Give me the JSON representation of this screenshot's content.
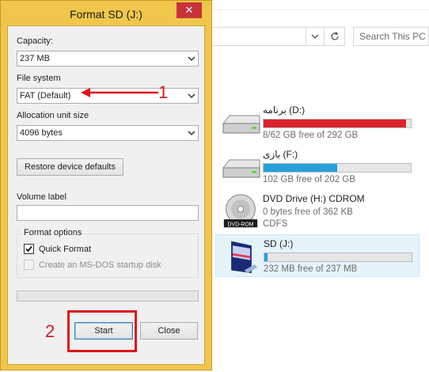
{
  "explorer": {
    "search_placeholder": "Search This PC",
    "drives": [
      {
        "name": "برنامه (D:)",
        "free_text": "8/62 GB free of 292 GB",
        "used_fraction": 0.97,
        "bar_color": "#d9252c"
      },
      {
        "name": "بازی (F:)",
        "free_text": "102 GB free of 202 GB",
        "used_fraction": 0.5,
        "bar_color": "#26a0da"
      },
      {
        "name": "DVD Drive (H:) CDROM",
        "free_text": "0 bytes free of 362 KB",
        "fs_text": "CDFS",
        "icon_label": "DVD-ROM"
      },
      {
        "name": "SD (J:)",
        "free_text": "232 MB free of 237 MB",
        "used_fraction": 0.02,
        "bar_color": "#26a0da"
      }
    ]
  },
  "dialog": {
    "title": "Format SD (J:)",
    "close_glyph": "✕",
    "capacity_label": "Capacity:",
    "capacity_value": "237 MB",
    "filesystem_label": "File system",
    "filesystem_value": "FAT (Default)",
    "alloc_label": "Allocation unit size",
    "alloc_value": "4096 bytes",
    "restore_label": "Restore device defaults",
    "volume_label": "Volume label",
    "volume_value": "",
    "format_options_label": "Format options",
    "quick_format_label": "Quick Format",
    "quick_format_checked": true,
    "msdos_label": "Create an MS-DOS startup disk",
    "msdos_checked": false,
    "progress": 0,
    "start_label": "Start",
    "close_label": "Close"
  },
  "annotations": {
    "step1": "1",
    "step2": "2",
    "color": "#e0141b"
  }
}
